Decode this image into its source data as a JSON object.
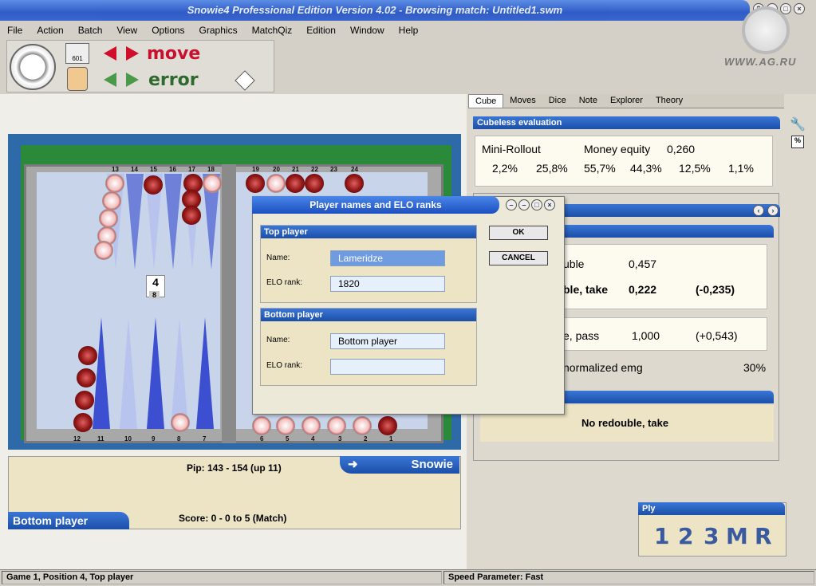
{
  "window": {
    "title": "Snowie4 Professional Edition Version 4.02 - Browsing match: Untitled1.swm",
    "watermark": "WWW.AG.RU"
  },
  "menu": [
    "File",
    "Action",
    "Batch",
    "View",
    "Options",
    "Graphics",
    "MatchQiz",
    "Edition",
    "Window",
    "Help"
  ],
  "toolbar": {
    "move_label": "move",
    "error_label": "error",
    "badge": "601"
  },
  "board": {
    "top_numbers": [
      "13",
      "14",
      "15",
      "16",
      "17",
      "18",
      "19",
      "20",
      "21",
      "22",
      "23",
      "24"
    ],
    "bottom_numbers": [
      "12",
      "11",
      "10",
      "9",
      "8",
      "7",
      "6",
      "5",
      "4",
      "3",
      "2",
      "1"
    ],
    "cube_value": "4",
    "cube_sub": "8"
  },
  "info": {
    "snowie": "Snowie",
    "pip": "Pip: 143 - 154 (up 11)",
    "player": "Bottom player",
    "score": "Score: 0 - 0 to 5 (Match)"
  },
  "right": {
    "tabs": [
      "Cube",
      "Moves",
      "Dice",
      "Note",
      "Explorer",
      "Theory"
    ],
    "cubeless_header": "Cubeless evaluation",
    "mini_rollout": "Mini-Rollout",
    "money_equity_label": "Money equity",
    "money_equity_value": "0,260",
    "percentages": [
      "2,2%",
      "25,8%",
      "55,7%",
      "44,3%",
      "12,5%",
      "1,1%"
    ],
    "row1_label": "uble",
    "row1_value": "0,457",
    "row2_label": "ble, take",
    "row2_value": "0,222",
    "row2_diff": "(-0,235)",
    "row3_label": "e, pass",
    "row3_value": "1,000",
    "row3_diff": "(+0,543)",
    "emg_label": "normalized emg",
    "emg_value": "30%",
    "decision": "No redouble, take",
    "ply_header": "Ply",
    "ply_buttons": [
      "1",
      "2",
      "3",
      "M",
      "R"
    ]
  },
  "dialog": {
    "title": "Player names and ELO ranks",
    "top_group": "Top player",
    "bottom_group": "Bottom player",
    "name_label": "Name:",
    "elo_label": "ELO rank:",
    "top_name": "Lameridze",
    "top_elo": "1820",
    "bottom_name": "Bottom player",
    "bottom_elo": "",
    "ok": "OK",
    "cancel": "CANCEL"
  },
  "status": {
    "left": "Game 1, Position 4, Top player",
    "right": "Speed Parameter: Fast"
  }
}
